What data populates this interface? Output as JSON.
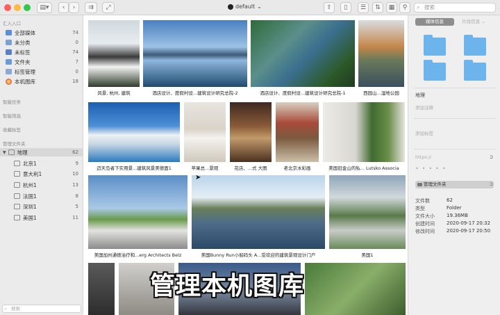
{
  "toolbar": {
    "library_name": "default",
    "search_placeholder": "搜索"
  },
  "sidebar": {
    "section_import": "汇入入口",
    "items": [
      {
        "label": "全部媒体",
        "count": "74",
        "color": "#5a8fd8"
      },
      {
        "label": "未分类",
        "count": "0",
        "color": "#7aa0d8"
      },
      {
        "label": "未标签",
        "count": "74",
        "color": "#5580c8"
      },
      {
        "label": "文件夹",
        "count": "7",
        "color": "#6a9ad8"
      },
      {
        "label": "标签管理",
        "count": "0",
        "color": "#8aa8d8"
      },
      {
        "label": "本机图库",
        "count": "18",
        "color": "#e0a040"
      }
    ],
    "smart_tasks": "智能任务",
    "smart_filter": "智能筛选",
    "favorites": "收藏标签",
    "manage_folders": "管理文件夹",
    "root_folder": {
      "label": "地理",
      "count": "62"
    },
    "subfolders": [
      {
        "label": "北京1",
        "count": "9"
      },
      {
        "label": "意大利1",
        "count": "10"
      },
      {
        "label": "杭州1",
        "count": "13"
      },
      {
        "label": "法国1",
        "count": "8"
      },
      {
        "label": "深圳1",
        "count": "5"
      },
      {
        "label": "美国1",
        "count": "11"
      }
    ],
    "search_placeholder": "搜索"
  },
  "grid": {
    "items": [
      {
        "caption": "风景, 杭州, 建筑"
      },
      {
        "caption": "酒店设计、度假村设...建筑设计研究总院-2"
      },
      {
        "caption": "酒店设计、度假村设...建筑设计研究总院-1"
      },
      {
        "caption": "西园山...湿地公园"
      },
      {
        "caption": "迈天岛者下实用景...建筑风景美德面1"
      },
      {
        "caption": "苹果总...景观"
      },
      {
        "caption": "花店、...式 大图"
      },
      {
        "caption": "老北京水彩画"
      },
      {
        "caption": "美国旧金山的私... Lutsko Associa"
      },
      {
        "caption": "美国加州通德治疗和...erg Architects  Belz"
      },
      {
        "caption": "美国Bunny Run小船码头  A...受欢迎的建筑景观设计门户"
      },
      {
        "caption": "美国1"
      },
      {
        "caption": ""
      },
      {
        "caption": ""
      },
      {
        "caption": ""
      },
      {
        "caption": ""
      }
    ],
    "overlay_caption": "管理本机图库"
  },
  "inspector": {
    "tab_media_info": "媒体信息",
    "tab_other": "片段信息",
    "section_place": "地理",
    "annotation_placeholder": "添加注释",
    "tags_placeholder": "添加标签",
    "url_placeholder": "https://",
    "manage_folder_button": "管理文件夹",
    "meta": [
      {
        "key": "文件数",
        "value": "62"
      },
      {
        "key": "类型",
        "value": "Folder"
      },
      {
        "key": "文件大小",
        "value": "19.36MB"
      },
      {
        "key": "创建时间",
        "value": "2020-09-17 20:32"
      },
      {
        "key": "修改时间",
        "value": "2020-09-17 20:50"
      }
    ]
  }
}
